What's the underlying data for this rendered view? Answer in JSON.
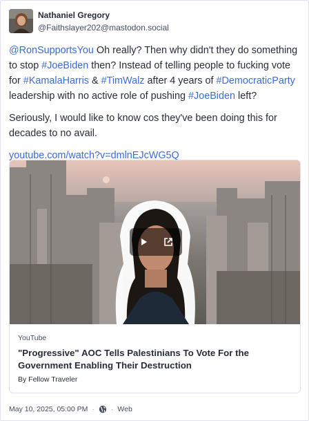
{
  "author": {
    "display_name": "Nathaniel Gregory",
    "acct": "@Faithslayer202@mastodon.social"
  },
  "status": {
    "para1": [
      {
        "t": "@RonSupportsYou",
        "link": true
      },
      {
        "t": " Oh really? Then why didn't they do something to stop ",
        "link": false
      },
      {
        "t": "#JoeBiden",
        "link": true
      },
      {
        "t": " then? Instead of telling people to fucking vote for ",
        "link": false
      },
      {
        "t": "#KamalaHarris",
        "link": true
      },
      {
        "t": " & ",
        "link": false
      },
      {
        "t": "#TimWalz",
        "link": true
      },
      {
        "t": " after 4 years of ",
        "link": false
      },
      {
        "t": "#DemocraticParty",
        "link": true
      },
      {
        "t": " leadership with no active role of pushing ",
        "link": false
      },
      {
        "t": "#JoeBiden",
        "link": true
      },
      {
        "t": " left?",
        "link": false
      }
    ],
    "para2": "Seriously, I would like to know cos they've been doing this for decades to no avail.",
    "link_text": "youtube.com/watch?v=dmlnEJcWG5Q"
  },
  "card": {
    "provider": "YouTube",
    "title": "\"Progressive\" AOC Tells Palestinians To Vote For the Government Enabling Their Destruction",
    "author": "By Fellow Traveler",
    "play_icon": "play-icon",
    "external_icon": "external-link-icon"
  },
  "meta": {
    "timestamp": "May 10, 2025, 05:00 PM",
    "separator": "·",
    "visibility_icon": "globe-icon",
    "application": "Web"
  },
  "colors": {
    "link": "#3a6bd9",
    "text": "#282c37",
    "muted": "#444b5d"
  }
}
